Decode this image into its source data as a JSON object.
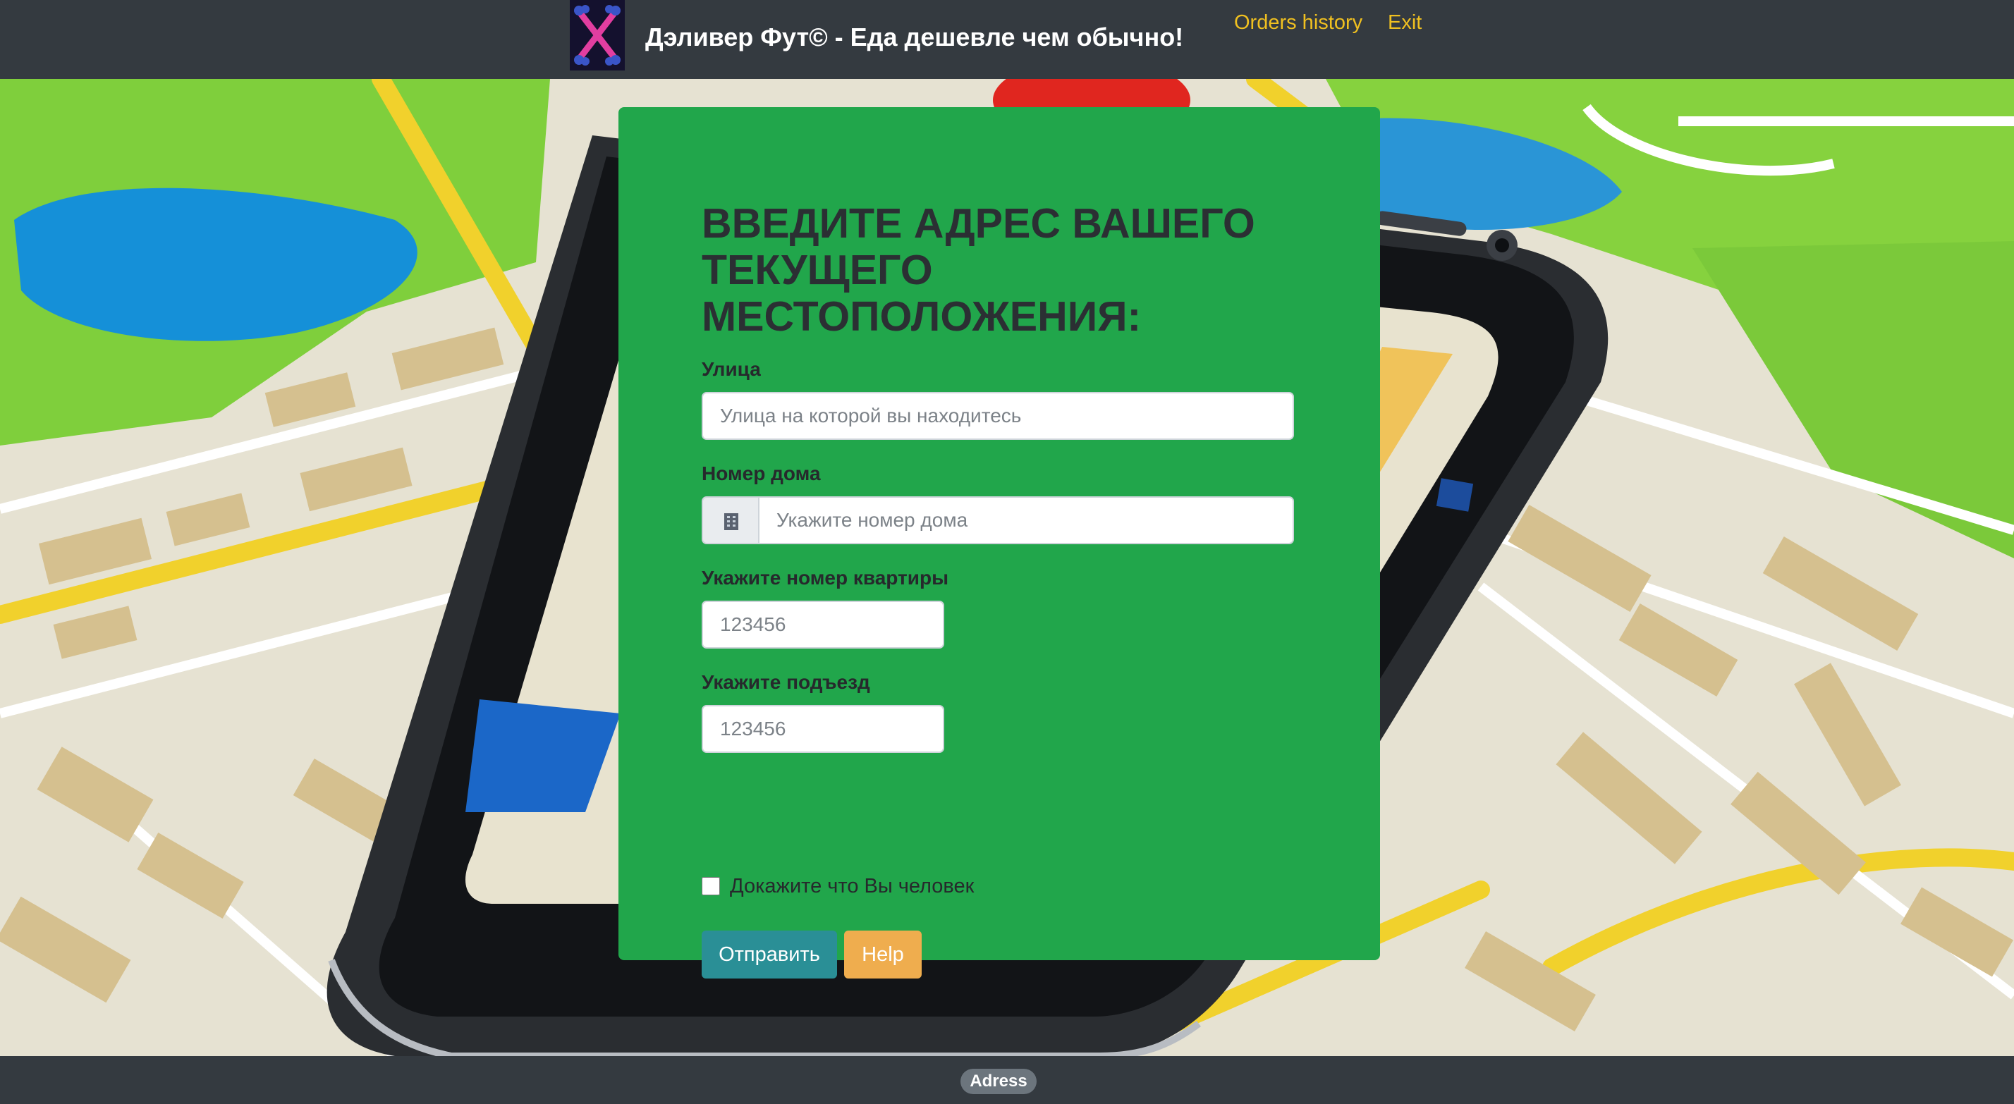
{
  "header": {
    "brand_title": "Дэливер Фут© - Еда дешевле чем обычно!",
    "logo_icon": "crossed-bones-logo-icon",
    "nav": {
      "orders_history": "Orders history",
      "exit": "Exit"
    }
  },
  "form": {
    "title": "ВВЕДИТЕ АДРЕС ВАШЕГО ТЕКУЩЕГО МЕСТОПОЛОЖЕНИЯ:",
    "street": {
      "label": "Улица",
      "placeholder": "Улица на которой вы находитесь",
      "value": ""
    },
    "house": {
      "label": "Номер дома",
      "addon_icon": "building-icon",
      "placeholder": "Укажите номер дома",
      "value": ""
    },
    "apartment": {
      "label": "Укажите номер квартиры",
      "placeholder": "123456",
      "value": ""
    },
    "entrance": {
      "label": "Укажите подъезд",
      "placeholder": "123456",
      "value": ""
    },
    "human_check": {
      "label": "Докажите что Вы человек",
      "checked": false
    },
    "submit_label": "Отправить",
    "help_label": "Help"
  },
  "footer": {
    "badge": "Adress"
  },
  "colors": {
    "navbar": "#343a40",
    "card": "#21a64b",
    "nav_link": "#f0c020",
    "submit": "#2a8f96",
    "help": "#efad4e",
    "badge": "#6c757d"
  }
}
